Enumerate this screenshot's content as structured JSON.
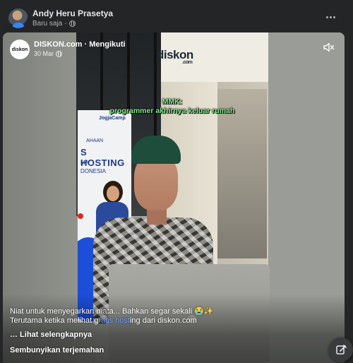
{
  "post": {
    "author": "Andy Heru Prasetya",
    "time": "Baru saja",
    "separator": "·",
    "privacy_icon": "globe-icon"
  },
  "shared": {
    "page_name": "DISKON.com",
    "follow_state": "Mengikuti",
    "date": "30 Mar",
    "page_logo_text": "diskon"
  },
  "video": {
    "watermark": "diskon",
    "watermark_sub": ".com",
    "caption_line1": "MMK:",
    "caption_line2": "programmer akhirnya keluar rumah",
    "banner_brand": "JogjaCamp",
    "banner_line1": "AHAAN",
    "banner_line2": "S HOSTING",
    "banner_line3": "MA",
    "banner_line4": "DONESIA"
  },
  "description": {
    "line1": "Niat untuk menyegarkan mata... Bahkan segar sekali 😭✨",
    "line2_prefix": "Terutama ketika melihat g",
    "line2_highlight": "ratis host",
    "line2_suffix": "ing dari diskon.com",
    "see_more": "… Lihat selengkapnya",
    "hide_translation": "Sembunyikan terjemahan"
  },
  "colors": {
    "caption_green": "#7ef08a",
    "link_blue": "#74a3ff",
    "card_bg": "#242526"
  }
}
